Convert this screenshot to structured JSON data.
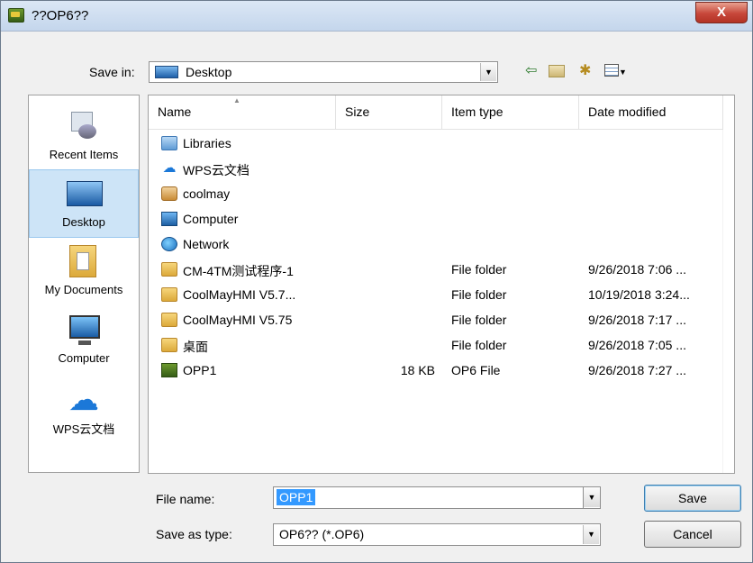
{
  "window": {
    "title": "??OP6??",
    "close_glyph": "X"
  },
  "save_in": {
    "label": "Save in:",
    "value": "Desktop"
  },
  "toolbar": {
    "icons": [
      "back-icon",
      "up-folder-icon",
      "new-folder-icon",
      "view-menu-icon"
    ]
  },
  "places": [
    {
      "label": "Recent Items",
      "icon": "recent-items-icon"
    },
    {
      "label": "Desktop",
      "icon": "desktop-icon",
      "selected": true
    },
    {
      "label": "My Documents",
      "icon": "documents-icon"
    },
    {
      "label": "Computer",
      "icon": "computer-icon"
    },
    {
      "label": "WPS云文档",
      "icon": "cloud-icon"
    }
  ],
  "columns": {
    "name": "Name",
    "size": "Size",
    "type": "Item type",
    "date": "Date modified"
  },
  "files": [
    {
      "name": "Libraries",
      "size": "",
      "type": "",
      "date": "",
      "icon": "libraries-icon"
    },
    {
      "name": "WPS云文档",
      "size": "",
      "type": "",
      "date": "",
      "icon": "cloud-icon"
    },
    {
      "name": "coolmay",
      "size": "",
      "type": "",
      "date": "",
      "icon": "user-folder-icon"
    },
    {
      "name": "Computer",
      "size": "",
      "type": "",
      "date": "",
      "icon": "computer-icon"
    },
    {
      "name": "Network",
      "size": "",
      "type": "",
      "date": "",
      "icon": "network-icon"
    },
    {
      "name": "CM-4TM测试程序-1",
      "size": "",
      "type": "File folder",
      "date": "9/26/2018 7:06 ...",
      "icon": "folder-icon"
    },
    {
      "name": "CoolMayHMI V5.7...",
      "size": "",
      "type": "File folder",
      "date": "10/19/2018 3:24...",
      "icon": "folder-icon"
    },
    {
      "name": "CoolMayHMI V5.75",
      "size": "",
      "type": "File folder",
      "date": "9/26/2018 7:17 ...",
      "icon": "folder-icon"
    },
    {
      "name": "桌面",
      "size": "",
      "type": "File folder",
      "date": "9/26/2018 7:05 ...",
      "icon": "folder-icon"
    },
    {
      "name": "OPP1",
      "size": "18 KB",
      "type": "OP6 File",
      "date": "9/26/2018 7:27 ...",
      "icon": "op6-file-icon"
    }
  ],
  "file_name": {
    "label": "File name:",
    "value": "OPP1"
  },
  "save_as_type": {
    "label": "Save as type:",
    "value": "OP6?? (*.OP6)"
  },
  "buttons": {
    "save": "Save",
    "cancel": "Cancel"
  }
}
